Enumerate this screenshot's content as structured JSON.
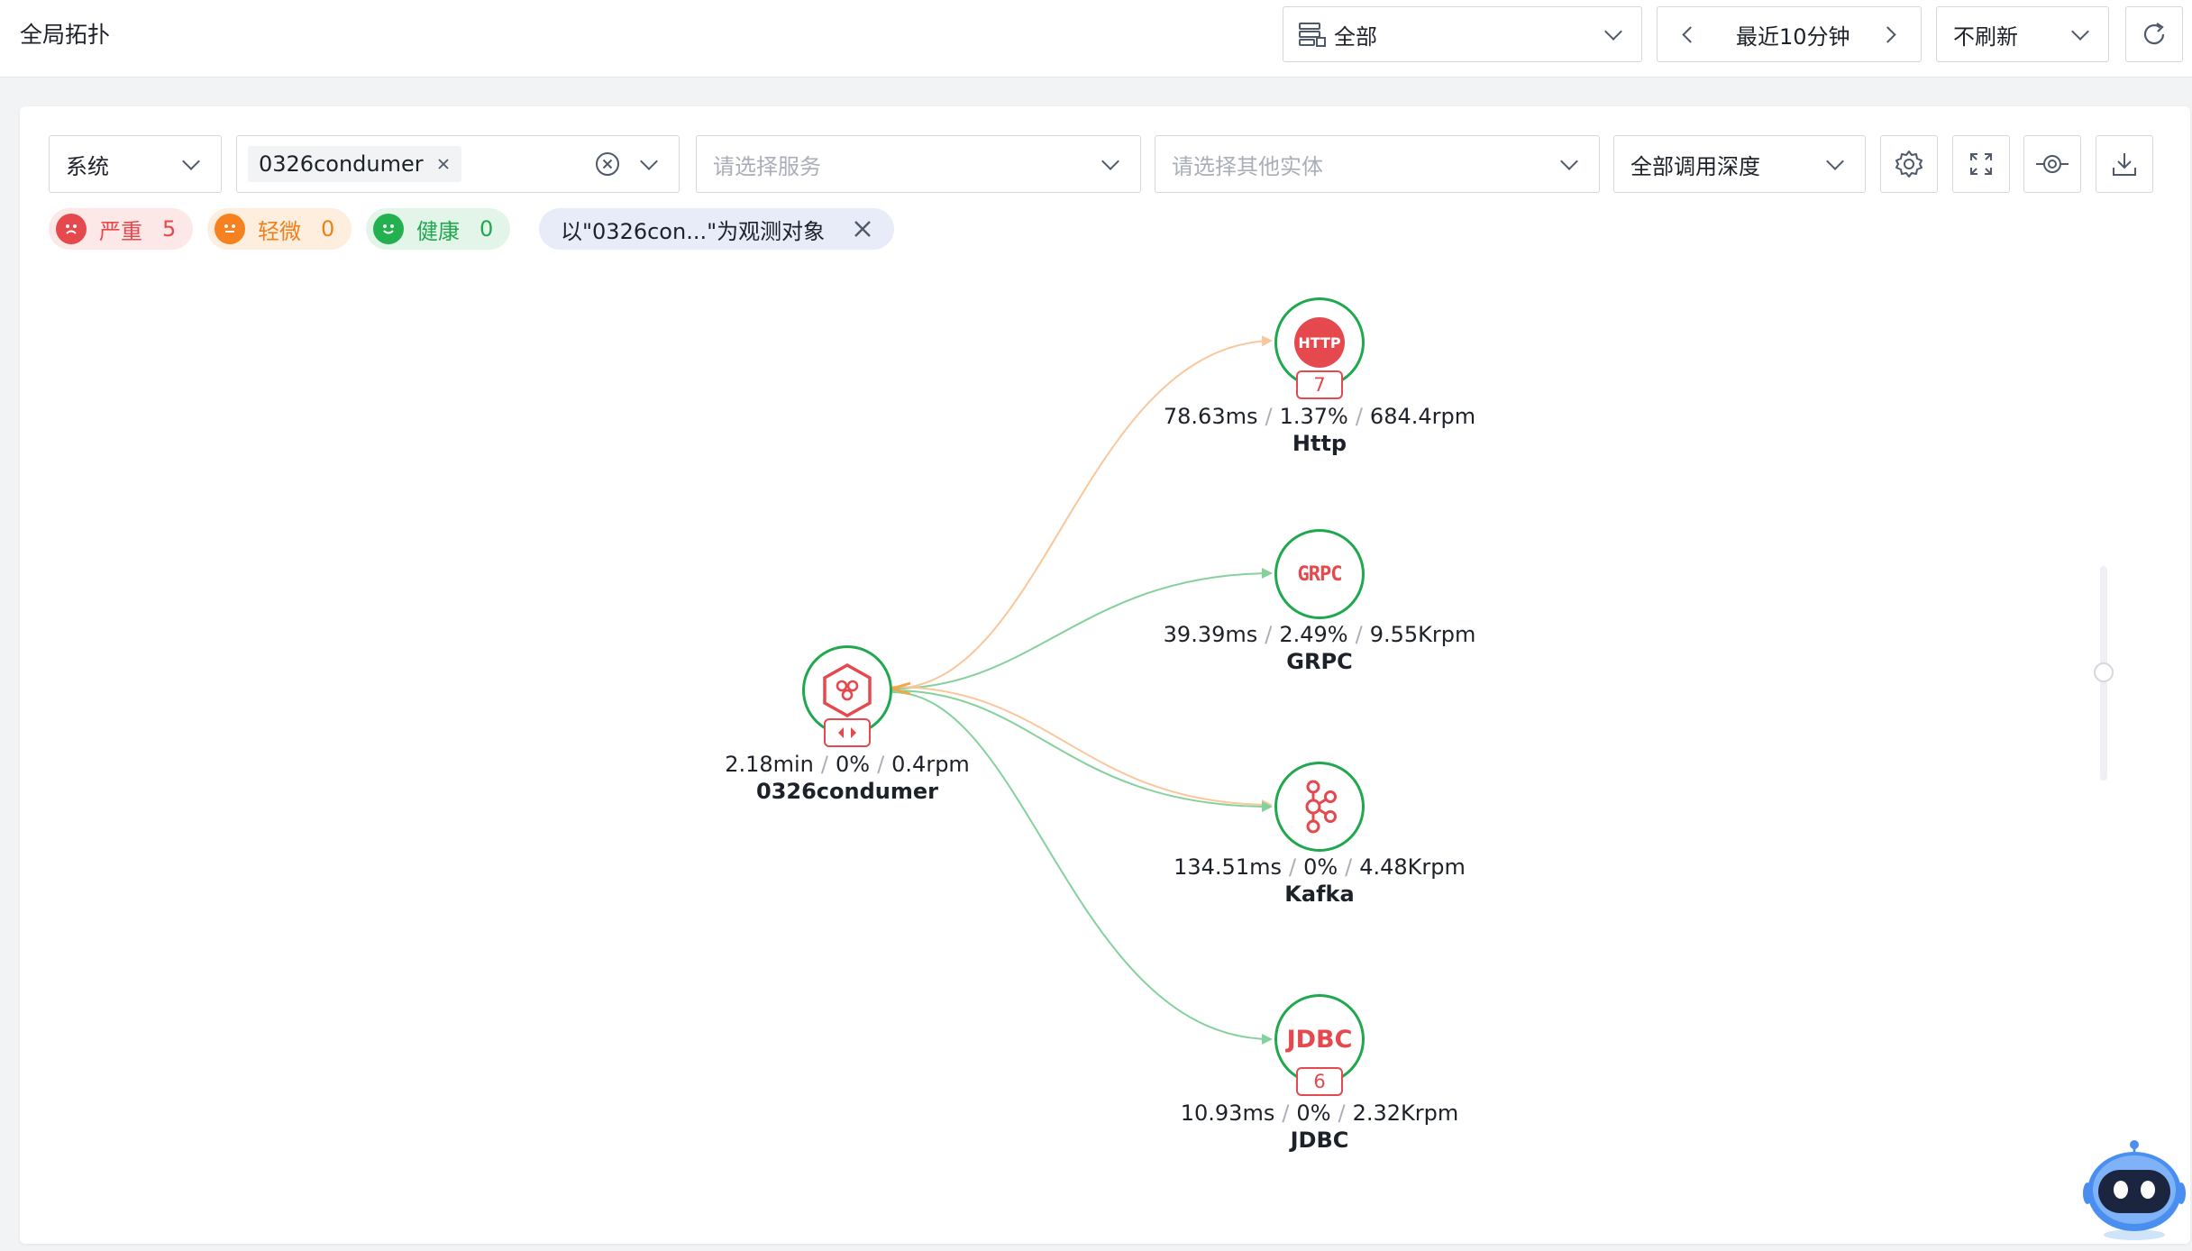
{
  "header": {
    "title": "全局拓扑",
    "scope_select": "全部",
    "time_range": "最近10分钟",
    "refresh_select": "不刷新"
  },
  "filters": {
    "level_select": "系统",
    "entity_chip": "0326condumer",
    "service_placeholder": "请选择服务",
    "other_entity_placeholder": "请选择其他实体",
    "depth_select": "全部调用深度"
  },
  "status": {
    "critical_label": "严重",
    "critical_count": "5",
    "minor_label": "轻微",
    "minor_count": "0",
    "healthy_label": "健康",
    "healthy_count": "0",
    "observe_tag": "以\"0326con...\"为观测对象"
  },
  "colors": {
    "healthy": "#1fa84e",
    "critical": "#e5484d",
    "minor": "#f5a54a",
    "edge_green": "#84d19c",
    "edge_orange": "#f9c79b"
  },
  "topology": {
    "center": {
      "icon": "service-hex-icon",
      "latency": "2.18min",
      "error_rate": "0%",
      "throughput": "0.4rpm",
      "name": "0326condumer"
    },
    "http": {
      "icon_text": "HTTP",
      "badge": "7",
      "latency": "78.63ms",
      "error_rate": "1.37%",
      "throughput": "684.4rpm",
      "name": "Http"
    },
    "grpc": {
      "icon_text": "GRPC",
      "latency": "39.39ms",
      "error_rate": "2.49%",
      "throughput": "9.55Krpm",
      "name": "GRPC"
    },
    "kafka": {
      "icon": "kafka-icon",
      "latency": "134.51ms",
      "error_rate": "0%",
      "throughput": "4.48Krpm",
      "name": "Kafka"
    },
    "jdbc": {
      "icon_text": "JDBC",
      "badge": "6",
      "latency": "10.93ms",
      "error_rate": "0%",
      "throughput": "2.32Krpm",
      "name": "JDBC"
    }
  }
}
